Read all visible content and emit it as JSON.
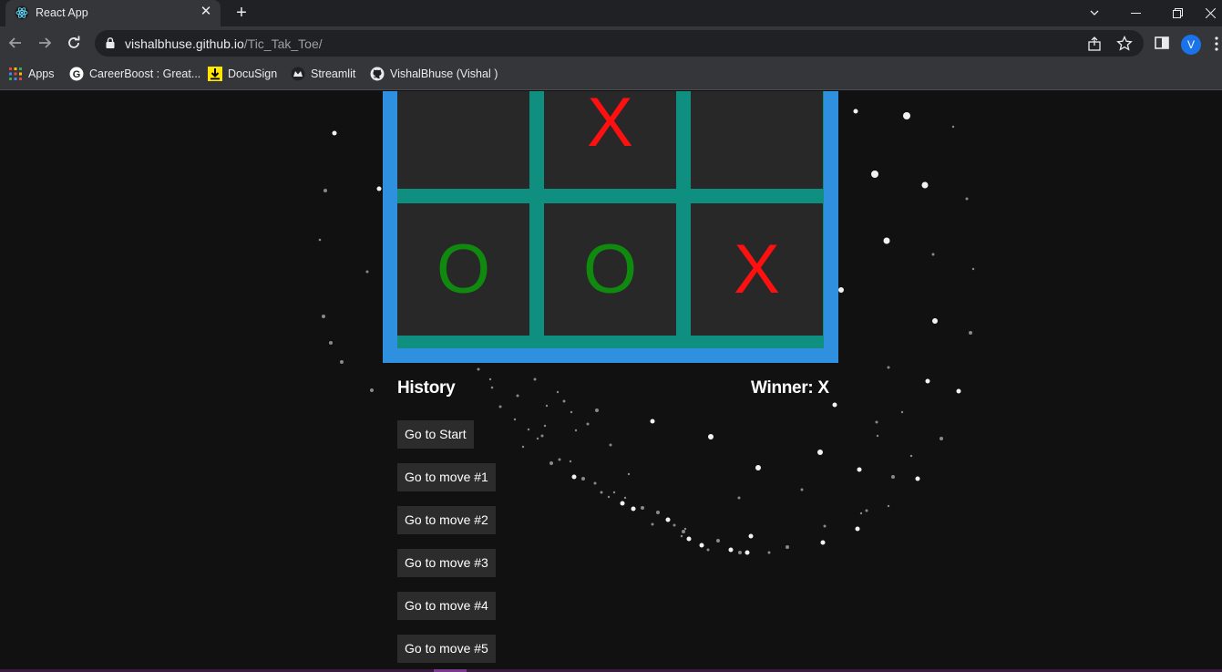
{
  "browser": {
    "tab_title": "React App",
    "url_host": "vishalbhuse.github.io",
    "url_path": "/Tic_Tak_Toe/",
    "avatar_letter": "V",
    "bookmarks": [
      {
        "label": "Apps",
        "icon": "apps-grid-icon"
      },
      {
        "label": "CareerBoost : Great...",
        "icon": "google-icon"
      },
      {
        "label": "DocuSign",
        "icon": "docusign-icon"
      },
      {
        "label": "Streamlit",
        "icon": "streamlit-icon"
      },
      {
        "label": "VishalBhuse (Vishal )",
        "icon": "github-icon"
      }
    ]
  },
  "game": {
    "board": [
      "",
      "X",
      "",
      "O",
      "O",
      "X"
    ],
    "colors": {
      "x": "#ff1010",
      "o": "#0f8a0f",
      "frame": "#3090e0",
      "grid": "#0e8f80",
      "cell": "#282828"
    },
    "history_title": "History",
    "winner_text": "Winner: X",
    "moves": [
      "Go to Start",
      "Go to move #1",
      "Go to move #2",
      "Go to move #3",
      "Go to move #4",
      "Go to move #5"
    ]
  }
}
